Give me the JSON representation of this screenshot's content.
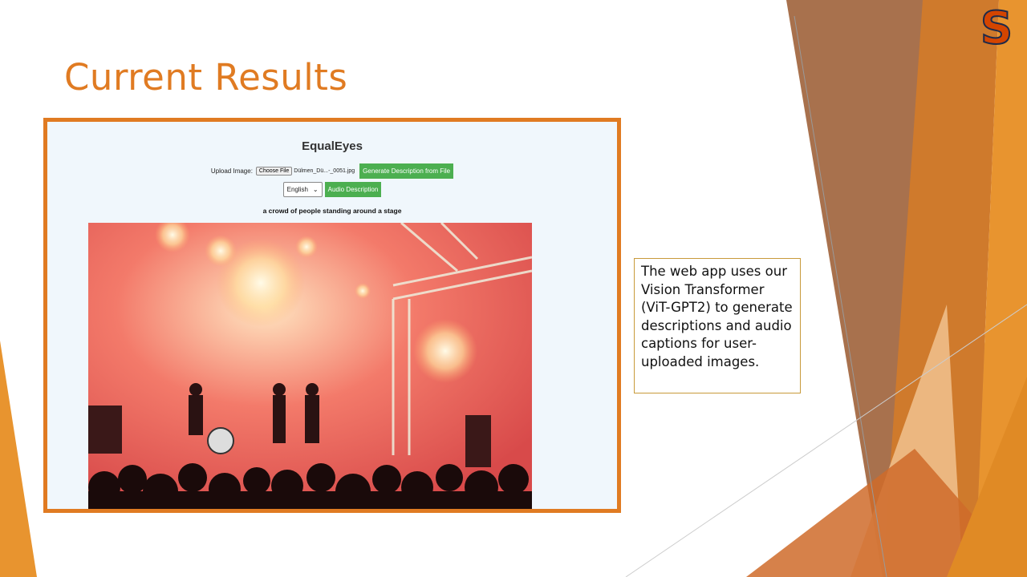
{
  "slide": {
    "title": "Current Results",
    "logo_letter": "S"
  },
  "app": {
    "title": "EqualEyes",
    "upload_label": "Upload Image:",
    "choose_file_label": "Choose File",
    "file_name": "Dülmen_Dü...-_0051.jpg",
    "generate_button": "Generate Description from File",
    "language_selected": "English",
    "audio_button": "Audio Description",
    "generated_caption": "a crowd of people standing around a stage"
  },
  "info_box": {
    "text": "The web app uses our Vision Transformer (ViT-GPT2) to generate descriptions and audio captions for user-uploaded images."
  },
  "colors": {
    "accent_orange": "#e07b22",
    "button_green": "#4caf50",
    "app_background": "#f0f7fc"
  }
}
